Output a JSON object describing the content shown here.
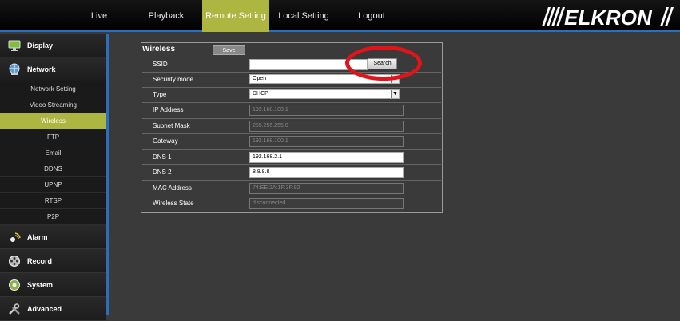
{
  "topnav": {
    "items": [
      {
        "label": "Live"
      },
      {
        "label": "Playback"
      },
      {
        "label": "Remote Setting"
      },
      {
        "label": "Local Setting"
      },
      {
        "label": "Logout"
      }
    ]
  },
  "logo": {
    "text": "ELKRON"
  },
  "sidebar": {
    "display": "Display",
    "network": "Network",
    "subs": [
      {
        "label": "Network Setting"
      },
      {
        "label": "Video Streaming"
      },
      {
        "label": "Wireless"
      },
      {
        "label": "FTP"
      },
      {
        "label": "Email"
      },
      {
        "label": "DDNS"
      },
      {
        "label": "UPNP"
      },
      {
        "label": "RTSP"
      },
      {
        "label": "P2P"
      }
    ],
    "alarm": "Alarm",
    "record": "Record",
    "system": "System",
    "advanced": "Advanced"
  },
  "panel": {
    "title": "Wireless",
    "save_label": "Save",
    "search_label": "Search",
    "rows": {
      "ssid": {
        "label": "SSID",
        "value": ""
      },
      "security": {
        "label": "Security mode",
        "value": "Open"
      },
      "type": {
        "label": "Type",
        "value": "DHCP"
      },
      "ip": {
        "label": "IP Address",
        "value": "192.168.100.1"
      },
      "mask": {
        "label": "Subnet Mask",
        "value": "255.255.255.0"
      },
      "gateway": {
        "label": "Gateway",
        "value": "192.168.100.1"
      },
      "dns1": {
        "label": "DNS 1",
        "value": "192.168.2.1"
      },
      "dns2": {
        "label": "DNS 2",
        "value": "8.8.8.8"
      },
      "mac": {
        "label": "MAC Address",
        "value": "74:EE:2A:1F:3F:92"
      },
      "state": {
        "label": "Wireless State",
        "value": "disconnected"
      }
    }
  },
  "colors": {
    "accent": "#adb640",
    "border_blue": "#2a6fbf",
    "annotation_red": "#e0141b"
  }
}
